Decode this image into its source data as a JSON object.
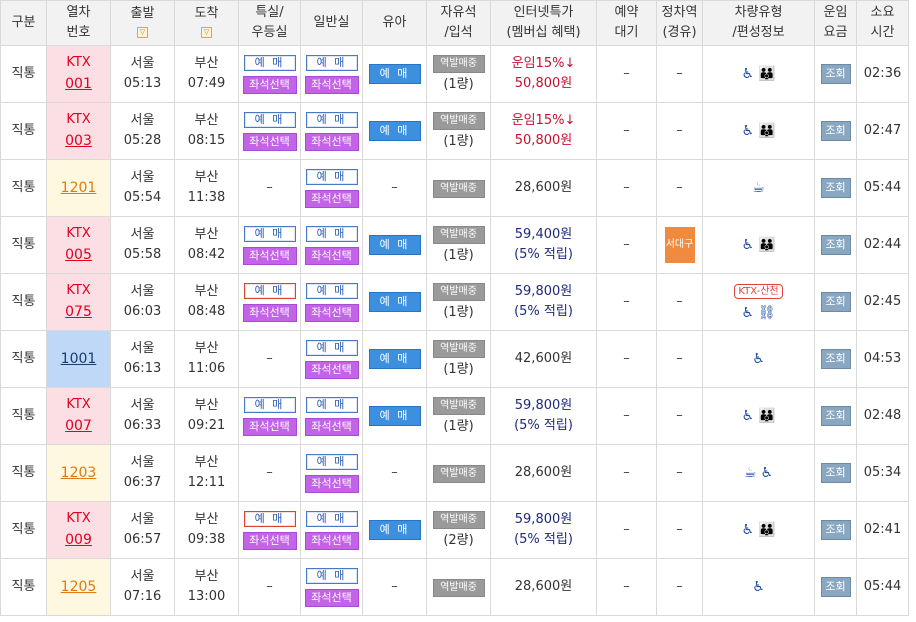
{
  "headers": {
    "type": "구분",
    "train_no": [
      "열차",
      "번호"
    ],
    "depart": "출발",
    "arrive": "도착",
    "special": [
      "특실/",
      "우등실"
    ],
    "general": "일반실",
    "infant": "유아",
    "free_seat": [
      "자유석",
      "/입석"
    ],
    "internet": [
      "인터넷특가",
      "(멤버십 혜택)"
    ],
    "waitlist": [
      "예약",
      "대기"
    ],
    "stop": [
      "정차역",
      "(경유)"
    ],
    "car_type": [
      "차량유형",
      "/편성정보"
    ],
    "fare": [
      "운임",
      "요금"
    ],
    "duration": [
      "소요",
      "시간"
    ],
    "sort_icon": "▽"
  },
  "labels": {
    "reserve": "예 매",
    "seat_select": "좌석선택",
    "station_sale": "역발매중",
    "inquiry": "조회",
    "dash": "–"
  },
  "rows": [
    {
      "type": "직통",
      "train": "KTX",
      "no": "001",
      "kind": "ktx",
      "from": "서울",
      "dep": "05:13",
      "to": "부산",
      "arr": "07:49",
      "special": true,
      "special_red": false,
      "infant": true,
      "free": "(1량)",
      "p1": "운임15%↓",
      "p2": "50,800원",
      "pstyle": "red",
      "wait": "–",
      "stop": "–",
      "stop_badge": "",
      "car": "wc-family",
      "car_label": "",
      "duration": "02:36"
    },
    {
      "type": "직통",
      "train": "KTX",
      "no": "003",
      "kind": "ktx",
      "from": "서울",
      "dep": "05:28",
      "to": "부산",
      "arr": "08:15",
      "special": true,
      "special_red": false,
      "infant": true,
      "free": "(1량)",
      "p1": "운임15%↓",
      "p2": "50,800원",
      "pstyle": "red",
      "wait": "–",
      "stop": "–",
      "stop_badge": "",
      "car": "wc-family",
      "car_label": "",
      "duration": "02:47"
    },
    {
      "type": "직통",
      "train": "",
      "no": "1201",
      "kind": "itx",
      "from": "서울",
      "dep": "05:54",
      "to": "부산",
      "arr": "11:38",
      "special": false,
      "special_red": false,
      "infant": false,
      "free": "",
      "p1": "",
      "p2": "28,600원",
      "pstyle": "plain",
      "wait": "–",
      "stop": "–",
      "stop_badge": "",
      "car": "cafe",
      "car_label": "",
      "duration": "05:44"
    },
    {
      "type": "직통",
      "train": "KTX",
      "no": "005",
      "kind": "ktx",
      "from": "서울",
      "dep": "05:58",
      "to": "부산",
      "arr": "08:42",
      "special": true,
      "special_red": false,
      "infant": true,
      "free": "(1량)",
      "p1": "59,400원",
      "p2": "(5% 적립)",
      "pstyle": "navy",
      "wait": "–",
      "stop": "",
      "stop_badge": "서대구",
      "car": "wc-family",
      "car_label": "",
      "duration": "02:44"
    },
    {
      "type": "직통",
      "train": "KTX",
      "no": "075",
      "kind": "ktx",
      "from": "서울",
      "dep": "06:03",
      "to": "부산",
      "arr": "08:48",
      "special": true,
      "special_red": true,
      "infant": true,
      "free": "(1량)",
      "p1": "59,800원",
      "p2": "(5% 적립)",
      "pstyle": "navy",
      "wait": "–",
      "stop": "–",
      "stop_badge": "",
      "car": "wc-meeting",
      "car_label": "KTX-산천",
      "duration": "02:45"
    },
    {
      "type": "직통",
      "train": "",
      "no": "1001",
      "kind": "mugunghwa",
      "from": "서울",
      "dep": "06:13",
      "to": "부산",
      "arr": "11:06",
      "special": false,
      "special_red": false,
      "infant": true,
      "free": "(1량)",
      "p1": "",
      "p2": "42,600원",
      "pstyle": "plain",
      "wait": "–",
      "stop": "–",
      "stop_badge": "",
      "car": "wc",
      "car_label": "",
      "duration": "04:53"
    },
    {
      "type": "직통",
      "train": "KTX",
      "no": "007",
      "kind": "ktx",
      "from": "서울",
      "dep": "06:33",
      "to": "부산",
      "arr": "09:21",
      "special": true,
      "special_red": false,
      "infant": true,
      "free": "(1량)",
      "p1": "59,800원",
      "p2": "(5% 적립)",
      "pstyle": "navy",
      "wait": "–",
      "stop": "–",
      "stop_badge": "",
      "car": "wc-family",
      "car_label": "",
      "duration": "02:48"
    },
    {
      "type": "직통",
      "train": "",
      "no": "1203",
      "kind": "itx",
      "from": "서울",
      "dep": "06:37",
      "to": "부산",
      "arr": "12:11",
      "special": false,
      "special_red": false,
      "infant": false,
      "free": "",
      "p1": "",
      "p2": "28,600원",
      "pstyle": "plain",
      "wait": "–",
      "stop": "–",
      "stop_badge": "",
      "car": "cafe-wc",
      "car_label": "",
      "duration": "05:34"
    },
    {
      "type": "직통",
      "train": "KTX",
      "no": "009",
      "kind": "ktx",
      "from": "서울",
      "dep": "06:57",
      "to": "부산",
      "arr": "09:38",
      "special": true,
      "special_red": true,
      "infant": true,
      "free": "(2량)",
      "p1": "59,800원",
      "p2": "(5% 적립)",
      "pstyle": "navy",
      "wait": "–",
      "stop": "–",
      "stop_badge": "",
      "car": "wc-family",
      "car_label": "",
      "duration": "02:41"
    },
    {
      "type": "직통",
      "train": "",
      "no": "1205",
      "kind": "itx",
      "from": "서울",
      "dep": "07:16",
      "to": "부산",
      "arr": "13:00",
      "special": false,
      "special_red": false,
      "infant": false,
      "free": "",
      "p1": "",
      "p2": "28,600원",
      "pstyle": "plain",
      "wait": "–",
      "stop": "–",
      "stop_badge": "",
      "car": "wc",
      "car_label": "",
      "duration": "05:44"
    }
  ],
  "icons": {
    "wc": "♿",
    "family": "👪",
    "cafe": "☕",
    "meeting": "⛓"
  }
}
